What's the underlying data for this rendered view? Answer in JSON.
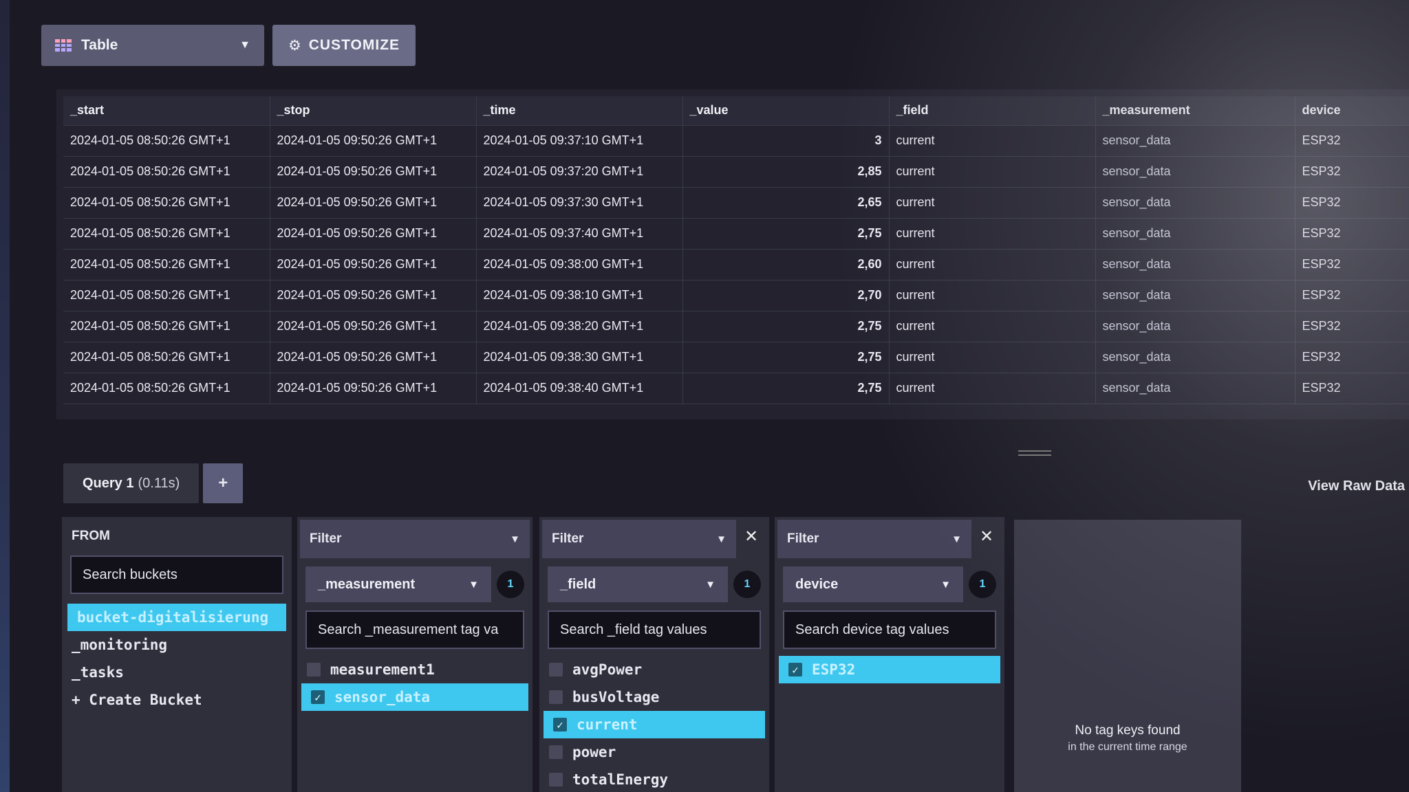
{
  "toolbar": {
    "view_label": "Table",
    "customize_label": "CUSTOMIZE"
  },
  "table": {
    "columns": [
      "_start",
      "_stop",
      "_time",
      "_value",
      "_field",
      "_measurement",
      "device"
    ],
    "rows": [
      [
        "2024-01-05 08:50:26 GMT+1",
        "2024-01-05 09:50:26 GMT+1",
        "2024-01-05 09:37:10 GMT+1",
        "3",
        "current",
        "sensor_data",
        "ESP32"
      ],
      [
        "2024-01-05 08:50:26 GMT+1",
        "2024-01-05 09:50:26 GMT+1",
        "2024-01-05 09:37:20 GMT+1",
        "2,85",
        "current",
        "sensor_data",
        "ESP32"
      ],
      [
        "2024-01-05 08:50:26 GMT+1",
        "2024-01-05 09:50:26 GMT+1",
        "2024-01-05 09:37:30 GMT+1",
        "2,65",
        "current",
        "sensor_data",
        "ESP32"
      ],
      [
        "2024-01-05 08:50:26 GMT+1",
        "2024-01-05 09:50:26 GMT+1",
        "2024-01-05 09:37:40 GMT+1",
        "2,75",
        "current",
        "sensor_data",
        "ESP32"
      ],
      [
        "2024-01-05 08:50:26 GMT+1",
        "2024-01-05 09:50:26 GMT+1",
        "2024-01-05 09:38:00 GMT+1",
        "2,60",
        "current",
        "sensor_data",
        "ESP32"
      ],
      [
        "2024-01-05 08:50:26 GMT+1",
        "2024-01-05 09:50:26 GMT+1",
        "2024-01-05 09:38:10 GMT+1",
        "2,70",
        "current",
        "sensor_data",
        "ESP32"
      ],
      [
        "2024-01-05 08:50:26 GMT+1",
        "2024-01-05 09:50:26 GMT+1",
        "2024-01-05 09:38:20 GMT+1",
        "2,75",
        "current",
        "sensor_data",
        "ESP32"
      ],
      [
        "2024-01-05 08:50:26 GMT+1",
        "2024-01-05 09:50:26 GMT+1",
        "2024-01-05 09:38:30 GMT+1",
        "2,75",
        "current",
        "sensor_data",
        "ESP32"
      ],
      [
        "2024-01-05 08:50:26 GMT+1",
        "2024-01-05 09:50:26 GMT+1",
        "2024-01-05 09:38:40 GMT+1",
        "2,75",
        "current",
        "sensor_data",
        "ESP32"
      ]
    ]
  },
  "query": {
    "tab_label": "Query 1",
    "tab_time": "(0.11s)",
    "add_label": "+",
    "view_raw_label": "View Raw Data"
  },
  "from": {
    "title": "FROM",
    "search_placeholder": "Search buckets",
    "buckets": [
      "bucket-digitalisierung",
      "_monitoring",
      "_tasks",
      "+ Create Bucket"
    ],
    "selected_index": 0
  },
  "filters": [
    {
      "title": "Filter",
      "key": "_measurement",
      "count": "1",
      "search_placeholder": "Search _measurement tag va",
      "values": [
        {
          "label": "measurement1",
          "checked": false
        },
        {
          "label": "sensor_data",
          "checked": true
        }
      ]
    },
    {
      "title": "Filter",
      "key": "_field",
      "count": "1",
      "search_placeholder": "Search _field tag values",
      "values": [
        {
          "label": "avgPower",
          "checked": false
        },
        {
          "label": "busVoltage",
          "checked": false
        },
        {
          "label": "current",
          "checked": true
        },
        {
          "label": "power",
          "checked": false
        },
        {
          "label": "totalEnergy",
          "checked": false
        }
      ]
    },
    {
      "title": "Filter",
      "key": "device",
      "count": "1",
      "search_placeholder": "Search device tag values",
      "values": [
        {
          "label": "ESP32",
          "checked": true
        }
      ]
    }
  ],
  "empty": {
    "line1": "No tag keys found",
    "line2": "in the current time range"
  },
  "icons": {
    "table": "table-icon",
    "gear": "gear-icon",
    "caret": "chevron-down-icon",
    "close": "close-icon",
    "check": "check-icon"
  }
}
